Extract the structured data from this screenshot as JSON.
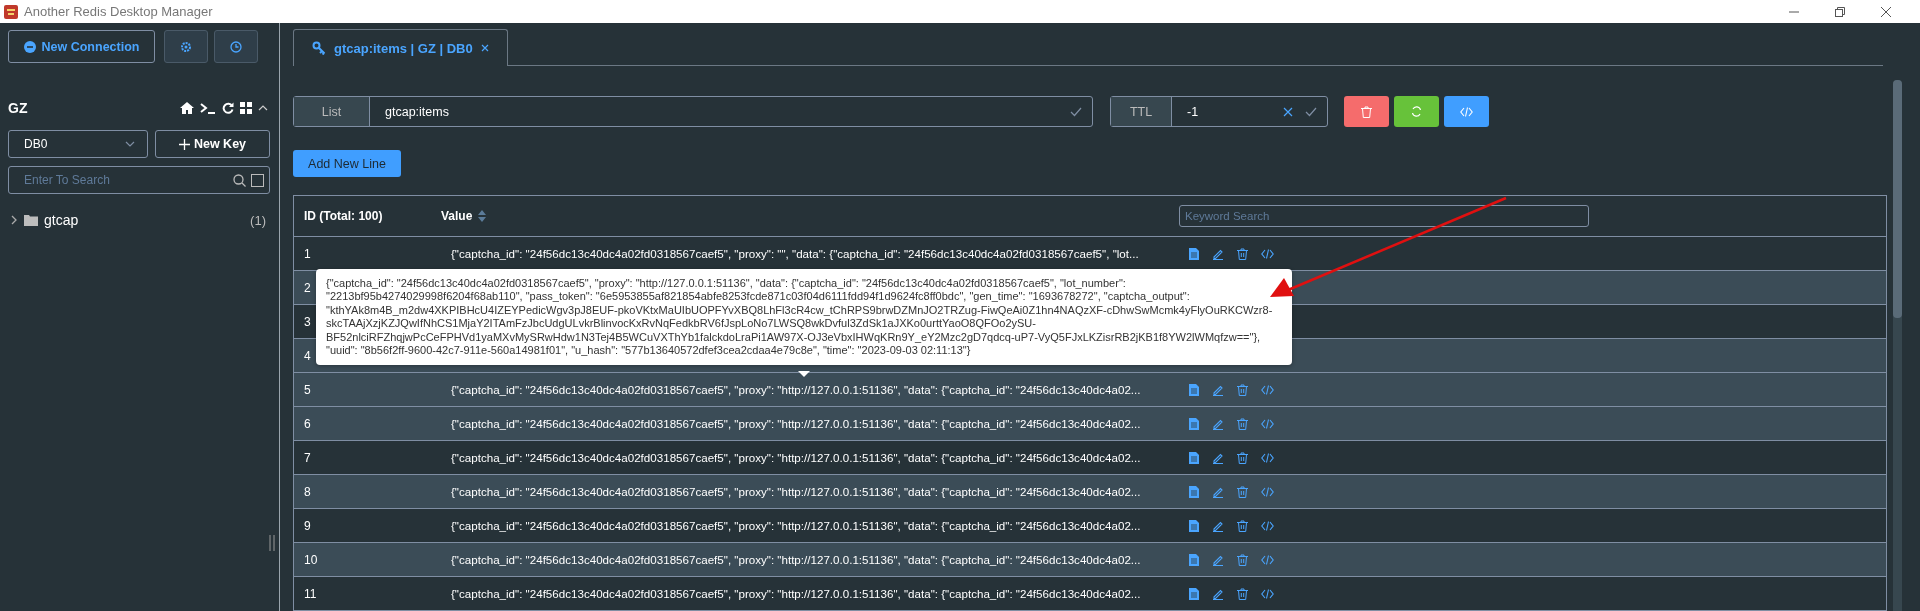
{
  "window": {
    "title": "Another Redis Desktop Manager"
  },
  "sidebar": {
    "new_connection_label": "New Connection",
    "connection": {
      "name": "GZ",
      "db": "DB0",
      "new_key_label": "New Key",
      "search_placeholder": "Enter To Search",
      "exact_search_checked": false
    },
    "tree": [
      {
        "name": "gtcap",
        "count": "(1)",
        "expanded": false
      }
    ]
  },
  "tabs": [
    {
      "label": "gtcap:items | GZ | DB0",
      "selected": true
    }
  ],
  "key": {
    "type": "List",
    "name": "gtcap:items",
    "ttl_label": "TTL",
    "ttl": "-1"
  },
  "add_line_label": "Add New Line",
  "table": {
    "columns": [
      "ID (Total: 100)",
      "Value"
    ],
    "keyword_placeholder": "Keyword Search",
    "rows": [
      {
        "id": "1",
        "value": "{\"captcha_id\": \"24f56dc13c40dc4a02fd0318567caef5\", \"proxy\": \"\", \"data\": {\"captcha_id\": \"24f56dc13c40dc4a02fd0318567caef5\", \"lot...",
        "highlighted": false
      },
      {
        "id": "2",
        "highlighted": true
      },
      {
        "id": "3",
        "highlighted": false
      },
      {
        "id": "4",
        "highlighted": true
      },
      {
        "id": "5",
        "value": "{\"captcha_id\": \"24f56dc13c40dc4a02fd0318567caef5\", \"proxy\": \"http://127.0.0.1:51136\", \"data\": {\"captcha_id\": \"24f56dc13c40dc4a02...",
        "highlighted": true
      },
      {
        "id": "6",
        "value": "{\"captcha_id\": \"24f56dc13c40dc4a02fd0318567caef5\", \"proxy\": \"http://127.0.0.1:51136\", \"data\": {\"captcha_id\": \"24f56dc13c40dc4a02...",
        "highlighted": true
      },
      {
        "id": "7",
        "value": "{\"captcha_id\": \"24f56dc13c40dc4a02fd0318567caef5\", \"proxy\": \"http://127.0.0.1:51136\", \"data\": {\"captcha_id\": \"24f56dc13c40dc4a02...",
        "highlighted": false
      },
      {
        "id": "8",
        "value": "{\"captcha_id\": \"24f56dc13c40dc4a02fd0318567caef5\", \"proxy\": \"http://127.0.0.1:51136\", \"data\": {\"captcha_id\": \"24f56dc13c40dc4a02...",
        "highlighted": true
      },
      {
        "id": "9",
        "value": "{\"captcha_id\": \"24f56dc13c40dc4a02fd0318567caef5\", \"proxy\": \"http://127.0.0.1:51136\", \"data\": {\"captcha_id\": \"24f56dc13c40dc4a02...",
        "highlighted": false
      },
      {
        "id": "10",
        "value": "{\"captcha_id\": \"24f56dc13c40dc4a02fd0318567caef5\", \"proxy\": \"http://127.0.0.1:51136\", \"data\": {\"captcha_id\": \"24f56dc13c40dc4a02...",
        "highlighted": true
      },
      {
        "id": "11",
        "value": "{\"captcha_id\": \"24f56dc13c40dc4a02fd0318567caef5\", \"proxy\": \"http://127.0.0.1:51136\", \"data\": {\"captcha_id\": \"24f56dc13c40dc4a02...",
        "highlighted": false
      }
    ]
  },
  "tooltip": {
    "text": "{\"captcha_id\": \"24f56dc13c40dc4a02fd0318567caef5\", \"proxy\": \"http://127.0.0.1:51136\", \"data\": {\"captcha_id\": \"24f56dc13c40dc4a02fd0318567caef5\", \"lot_number\": \"2213bf95b4274029998f6204f68ab110\", \"pass_token\": \"6e5953855af821854abfe8253fcde871c03f04d6111fdd94f1d9624fc8ff0bdc\", \"gen_time\": \"1693678272\", \"captcha_output\": \"kthYAk8m4B_m2dw4XKPIBHcU4IZEYPedicWgv3pJ8EUF-pkoVKtxMaUIbUOPFYvXBQ8LhFl3cR4cw_tChRPS9brwDZMnJO2TRZug-FiwQeAi0Z1hn4NAQzXF-cDhwSwMcmk4yFlyOuRKCWzr8-skcTAAjXzjKZJQwIfNhCS1MjaY2ITAmFzJbcUdgULvkrBlinvocKxRvNqFedkbRV6fJspLoNo7LWSQ8wkDvful3ZdSk1aJXKo0urttYaoO8QFOo2ySU-BF52nlciRFZhqjwPcCeFPHVd1yaMXvMySRwHdw1N3Tej4B5WCuVXThYb1falckdoLraPi1AW97X-OJ3eVbxIHWqKRn9Y_eY2Mzc2gD7qdcq-uP7-VyQ5FJxLKZisrRB2jKB1f8YW2lWMqfzw==\"}, \"uuid\": \"8b56f2ff-9600-42c7-911e-560a14981f01\", \"u_hash\": \"577b13640572dfef3cea2cdaa4e79c8e\", \"time\": \"2023-09-03 02:11:13\"}"
  }
}
